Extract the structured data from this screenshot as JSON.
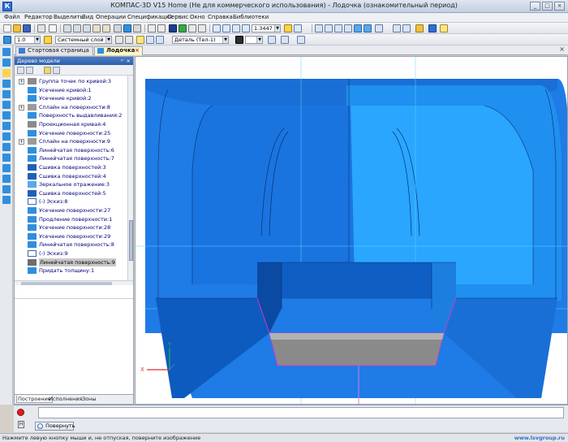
{
  "window": {
    "title": "КОМПАС-3D V15 Home (Не для коммерческого использования) - Лодочка (ознакомительный период)",
    "app_icon_text": "К",
    "controls": [
      "_",
      "□",
      "×"
    ]
  },
  "menu": [
    "Файл",
    "Редактор",
    "Выделить",
    "Вид",
    "Операции",
    "Спецификация",
    "Сервис",
    "Окно",
    "Справка",
    "Библиотеки"
  ],
  "toolbar": {
    "zoom_value": "1.3447",
    "line_scale": "1.0",
    "layer": "Системный слой (0)",
    "part_state": "Деталь (Тел-1)"
  },
  "tabs": [
    {
      "label": "Стартовая страница",
      "active": false
    },
    {
      "label": "Лодочка",
      "active": true
    }
  ],
  "tree": {
    "panel_title": "Дерево модели",
    "items": [
      {
        "label": "Группа точек по кривой:3",
        "expand": "+"
      },
      {
        "label": "Усечение кривой:1",
        "expand": ""
      },
      {
        "label": "Усечение кривой:2",
        "expand": ""
      },
      {
        "label": "Сплайн на поверхности:8",
        "expand": "+"
      },
      {
        "label": "Поверхность выдавливания:2",
        "expand": ""
      },
      {
        "label": "Проекционная кривая:4",
        "expand": ""
      },
      {
        "label": "Усечение поверхности:25",
        "expand": ""
      },
      {
        "label": "Сплайн на поверхности:9",
        "expand": "+"
      },
      {
        "label": "Линейчатая поверхность:6",
        "expand": ""
      },
      {
        "label": "Линейчатая поверхность:7",
        "expand": ""
      },
      {
        "label": "Сшивка поверхностей:3",
        "expand": ""
      },
      {
        "label": "Сшивка поверхностей:4",
        "expand": ""
      },
      {
        "label": "Зеркальное отражение:3",
        "expand": ""
      },
      {
        "label": "Сшивка поверхностей:5",
        "expand": ""
      },
      {
        "label": "(-) Эскиз:8",
        "expand": ""
      },
      {
        "label": "Усечение поверхности:27",
        "expand": ""
      },
      {
        "label": "Продление поверхности:1",
        "expand": ""
      },
      {
        "label": "Усечение поверхности:28",
        "expand": ""
      },
      {
        "label": "Усечение поверхности:29",
        "expand": ""
      },
      {
        "label": "Линейчатая поверхность:8",
        "expand": ""
      },
      {
        "label": "(-) Эскиз:9",
        "expand": ""
      },
      {
        "label": "Линейчатая поверхность:9",
        "expand": "",
        "selected": true
      },
      {
        "label": "Придать толщину:1",
        "expand": ""
      }
    ],
    "bottom_tabs": [
      "Построение",
      "Исполнения",
      "Зоны"
    ]
  },
  "viewport": {
    "axis_x_label": "X",
    "axis_y_label": "Y",
    "colors": {
      "body": "#1f7be6",
      "dark_face": "#0d5bbf",
      "light_face": "#2fa8ff",
      "cut_face": "#8a8a8a",
      "edge": "#0a2f6b",
      "highlight": "#c33bd1"
    }
  },
  "command_panel": {
    "stop_icon": "stop-icon",
    "rotate_button": "Повернуть",
    "side_marker": "Н"
  },
  "status": {
    "hint": "Нажмите левую кнопку мыши и, не отпуская, поверните изображение",
    "watermark": "www.lsvgroup.ru"
  }
}
